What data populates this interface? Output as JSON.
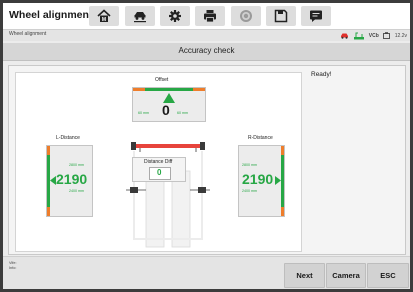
{
  "app": {
    "title": "Wheel alignment"
  },
  "toolbar": {
    "icons": [
      "home-icon",
      "car-lift-icon",
      "gear-icon",
      "print-icon",
      "record-icon",
      "save-icon",
      "message-icon"
    ]
  },
  "status": {
    "breadcrumb": "Wheel alignment",
    "vci_label": "VCb",
    "battery": "12.2v"
  },
  "page": {
    "title": "Accuracy check"
  },
  "main": {
    "status_text": "Ready!",
    "offset": {
      "label": "Offset",
      "value": "0",
      "left_mm": "60 mm",
      "right_mm": "60 mm"
    },
    "l_distance": {
      "label": "L-Distance",
      "value": "2190",
      "upper_mm": "2800 mm",
      "lower_mm": "2400 mm"
    },
    "r_distance": {
      "label": "R-Distance",
      "value": "2190",
      "upper_mm": "2800 mm",
      "lower_mm": "2400 mm"
    },
    "distance_diff": {
      "label": "Distance Diff",
      "value": "0"
    }
  },
  "footer": {
    "line1": "Vife:",
    "line2": "Info:"
  },
  "buttons": {
    "next": "Next",
    "camera": "Camera",
    "esc": "ESC"
  },
  "colors": {
    "green": "#27a745",
    "orange": "#ee7d2b",
    "red": "#e0302b"
  }
}
